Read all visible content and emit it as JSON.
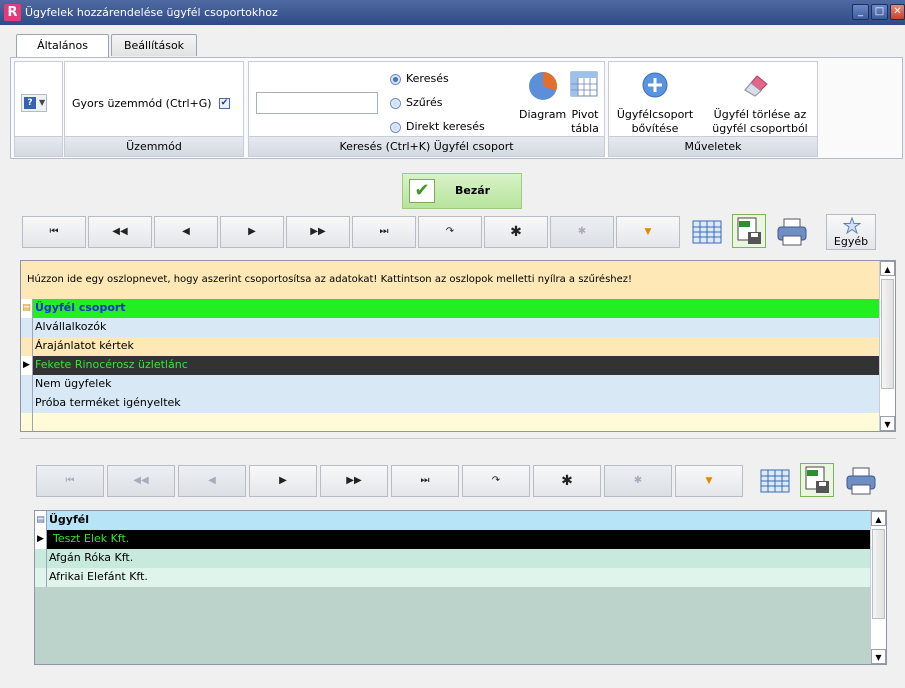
{
  "window": {
    "title": "Ügyfelek hozzárendelése ügyfél csoportokhoz"
  },
  "tabs": [
    {
      "label": "Általános"
    },
    {
      "label": "Beállítások"
    }
  ],
  "ribbon": {
    "uzemmod": {
      "fast_mode_label": "Gyors üzemmód (Ctrl+G)",
      "fast_mode_checked": true,
      "group_label": "Üzemmód"
    },
    "kereses": {
      "search_value": "",
      "options": [
        {
          "label": "Keresés",
          "selected": true
        },
        {
          "label": "Szűrés",
          "selected": false
        },
        {
          "label": "Direkt keresés",
          "selected": false
        }
      ],
      "diagram_label": "Diagram",
      "pivot_label_1": "Pivot",
      "pivot_label_2": "tábla",
      "group_label": "Keresés (Ctrl+K) Ügyfél csoport"
    },
    "muveletek": {
      "add_label_1": "Ügyfélcsoport",
      "add_label_2": "bővítése",
      "delete_label_1": "Ügyfél törlése az",
      "delete_label_2": "ügyfél csoportból",
      "group_label": "Műveletek"
    }
  },
  "close_button": {
    "label": "Bezár"
  },
  "nav_top": {
    "more_label": "Egyéb"
  },
  "group_grid": {
    "hint": "Húzzon ide egy oszlopnevet, hogy aszerint csoportosítsa az adatokat! Kattintson az oszlopok melletti nyílra a szűréshez!",
    "header": "Ügyfél csoport",
    "rows": [
      "Alvállalkozók",
      "Árajánlatot kértek",
      "Fekete Rinocérosz üzletlánc",
      "Nem ügyfelek",
      "Próba terméket igényeltek"
    ],
    "selected_index": 2
  },
  "client_grid": {
    "header": "Ügyfél",
    "rows": [
      "Teszt Elek Kft.",
      "Afgán Róka Kft.",
      "Afrikai Elefánt Kft."
    ],
    "selected_index": 0
  },
  "colors": {
    "accent_green": "#22ee22",
    "header_blue": "#b7e5f7",
    "selected_row": "#333333"
  }
}
